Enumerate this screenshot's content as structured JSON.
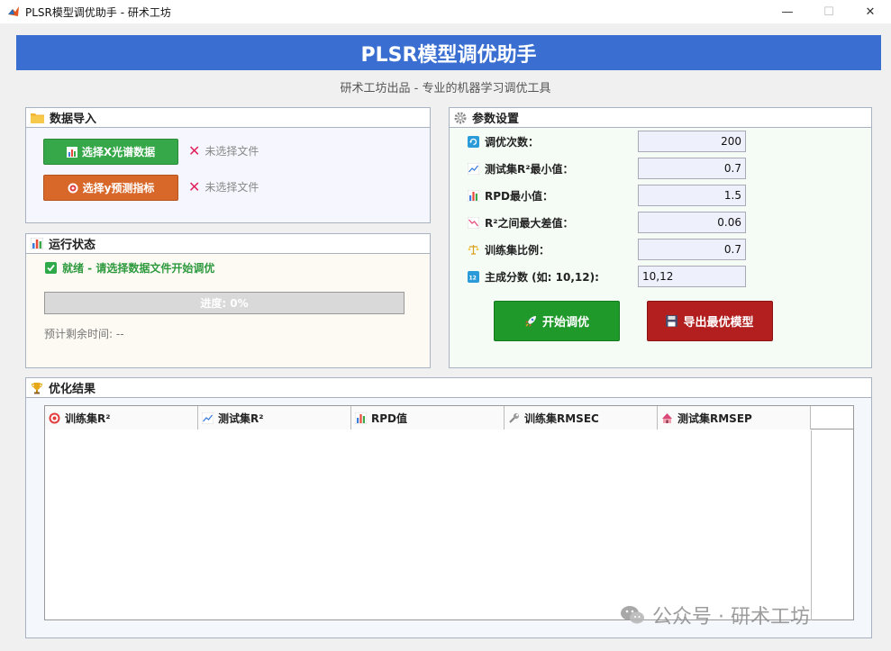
{
  "window": {
    "title": "PLSR模型调优助手 - 研术工坊",
    "minimize": "—",
    "maximize": "☐",
    "close": "✕"
  },
  "banner": {
    "title": "PLSR模型调优助手"
  },
  "subtitle": "研术工坊出品 - 专业的机器学习调优工具",
  "import_panel": {
    "title": "数据导入",
    "select_x_label": "选择X光谱数据",
    "select_y_label": "选择y预测指标",
    "x_status": "未选择文件",
    "y_status": "未选择文件"
  },
  "status_panel": {
    "title": "运行状态",
    "ready_text": "就绪 - 请选择数据文件开始调优",
    "progress_text": "进度: 0%",
    "progress_value": 0,
    "eta_text": "预计剩余时间: --"
  },
  "params_panel": {
    "title": "参数设置",
    "rows": [
      {
        "label": "调优次数：",
        "value": "200",
        "icon": "refresh-icon"
      },
      {
        "label": "测试集R²最小值：",
        "value": "0.7",
        "icon": "chart-up-icon"
      },
      {
        "label": "RPD最小值：",
        "value": "1.5",
        "icon": "bar-chart-icon"
      },
      {
        "label": "R²之间最大差值：",
        "value": "0.06",
        "icon": "chart-down-icon"
      },
      {
        "label": "训练集比例：",
        "value": "0.7",
        "icon": "scale-icon"
      },
      {
        "label": "主成分数 (如: 10,12):",
        "value": "10,12",
        "icon": "numbers-icon"
      }
    ],
    "start_label": "开始调优",
    "export_label": "导出最优模型"
  },
  "results_panel": {
    "title": "优化结果",
    "columns": [
      {
        "label": "训练集R²",
        "icon": "target-icon"
      },
      {
        "label": "测试集R²",
        "icon": "chart-up-icon"
      },
      {
        "label": "RPD值",
        "icon": "bar-chart-icon"
      },
      {
        "label": "训练集RMSEC",
        "icon": "wrench-icon"
      },
      {
        "label": "测试集RMSEP",
        "icon": "circus-tent-icon"
      }
    ]
  },
  "watermark": "公众号 · 研术工坊",
  "colors": {
    "banner": "#3a6fd1",
    "green_button": "#36a84a",
    "orange_button": "#d8672a",
    "start_button": "#1f9a2a",
    "export_button": "#b31e1e"
  }
}
